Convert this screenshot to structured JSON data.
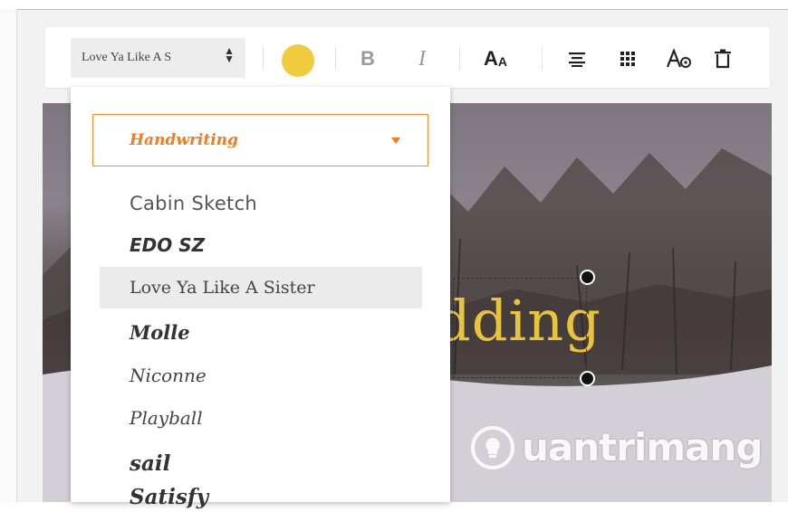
{
  "toolbar": {
    "font_value": "Love Ya Like A S",
    "color": "#f0cb3e",
    "bold_label": "B",
    "italic_label": "I",
    "size_label_big": "A",
    "size_label_small": "A"
  },
  "dropdown": {
    "category": "Handwriting",
    "fonts": [
      "Cabin Sketch",
      "EDO SZ",
      "Love Ya Like A Sister",
      "Molle",
      "Niconne",
      "Playball",
      "sail",
      "Satisfy"
    ],
    "selected_font": "Love Ya Like A Sister"
  },
  "canvas": {
    "text": "dding",
    "text_color": "#e8c33e"
  },
  "watermark": {
    "text": "uantrimang"
  },
  "icons": [
    "chevron-updown-icon",
    "align-center-icon",
    "grid-icon",
    "text-effect-icon",
    "trash-icon",
    "caret-down-icon"
  ],
  "colors": {
    "accent": "#f47b20",
    "selected_bg": "#ebebeb"
  }
}
